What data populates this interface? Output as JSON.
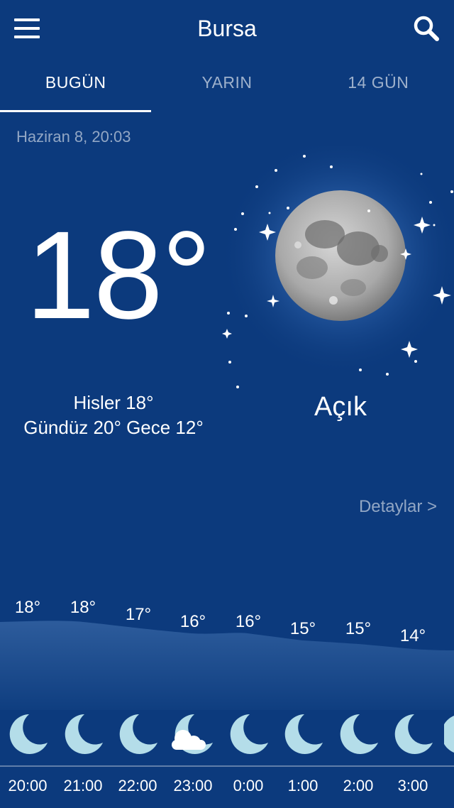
{
  "header": {
    "city": "Bursa",
    "menu_icon": "hamburger-menu-icon",
    "search_icon": "search-icon"
  },
  "tabs": [
    {
      "label": "BUGÜN",
      "active": true
    },
    {
      "label": "YARIN",
      "active": false
    },
    {
      "label": "14 GÜN",
      "active": false
    }
  ],
  "current": {
    "date": "Haziran 8, 20:03",
    "temperature": "18°",
    "feels_like": "Hisler 18°",
    "day_night": "Gündüz 20° Gece 12°",
    "condition": "Açık",
    "condition_icon": "full-moon-icon",
    "details_link": "Detaylar >"
  },
  "hourly": [
    {
      "temp": "18°",
      "time": "20:00",
      "icon": "crescent-moon-icon"
    },
    {
      "temp": "18°",
      "time": "21:00",
      "icon": "crescent-moon-icon"
    },
    {
      "temp": "17°",
      "time": "22:00",
      "icon": "crescent-moon-icon"
    },
    {
      "temp": "16°",
      "time": "23:00",
      "icon": "moon-cloud-icon"
    },
    {
      "temp": "16°",
      "time": "0:00",
      "icon": "crescent-moon-icon"
    },
    {
      "temp": "15°",
      "time": "1:00",
      "icon": "crescent-moon-icon"
    },
    {
      "temp": "15°",
      "time": "2:00",
      "icon": "crescent-moon-icon"
    },
    {
      "temp": "14°",
      "time": "3:00",
      "icon": "crescent-moon-icon"
    }
  ],
  "colors": {
    "background": "#0c3a7d",
    "moon_icon": "#b4dde9"
  }
}
